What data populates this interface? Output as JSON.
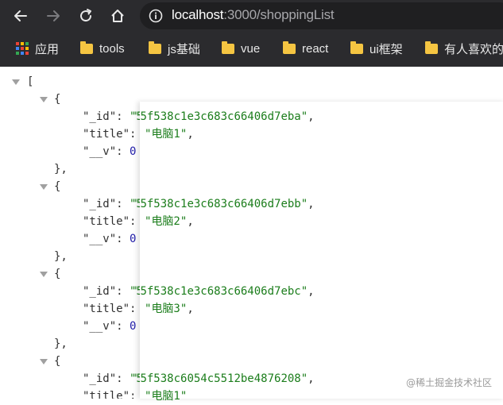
{
  "browser": {
    "url_host": "localhost",
    "url_rest": ":3000/shoppingList",
    "icons": {
      "back": "arrow-left-icon",
      "forward": "arrow-right-icon",
      "reload": "reload-icon",
      "home": "home-icon",
      "info": "info-icon"
    }
  },
  "bookmarks": [
    {
      "label": "应用",
      "icon": "apps-grid-icon"
    },
    {
      "label": "tools",
      "icon": "folder-icon"
    },
    {
      "label": "js基础",
      "icon": "folder-icon"
    },
    {
      "label": "vue",
      "icon": "folder-icon"
    },
    {
      "label": "react",
      "icon": "folder-icon"
    },
    {
      "label": "ui框架",
      "icon": "folder-icon"
    },
    {
      "label": "有人喜欢的",
      "icon": "folder-icon"
    }
  ],
  "json": {
    "open_bracket": "[",
    "items": [
      {
        "id": "5f538c1e3c683c66406d7eba",
        "title": "电脑1",
        "v": "0"
      },
      {
        "id": "5f538c1e3c683c66406d7ebb",
        "title": "电脑2",
        "v": "0"
      },
      {
        "id": "5f538c1e3c683c66406d7ebc",
        "title": "电脑3",
        "v": "0"
      },
      {
        "id": "5f538c6054c5512be4876208",
        "title": "电脑1",
        "v": ""
      }
    ],
    "keys": {
      "id": "\"_id\"",
      "title": "\"title\"",
      "v": "\"__v\""
    }
  },
  "watermark": "@稀土掘金技术社区",
  "colors": {
    "chrome_bg": "#2b2b2e",
    "omnibox_bg": "#1f1f21",
    "folder": "#f5c542",
    "json_string": "#1b7d1b",
    "json_number": "#1f1ba8"
  }
}
